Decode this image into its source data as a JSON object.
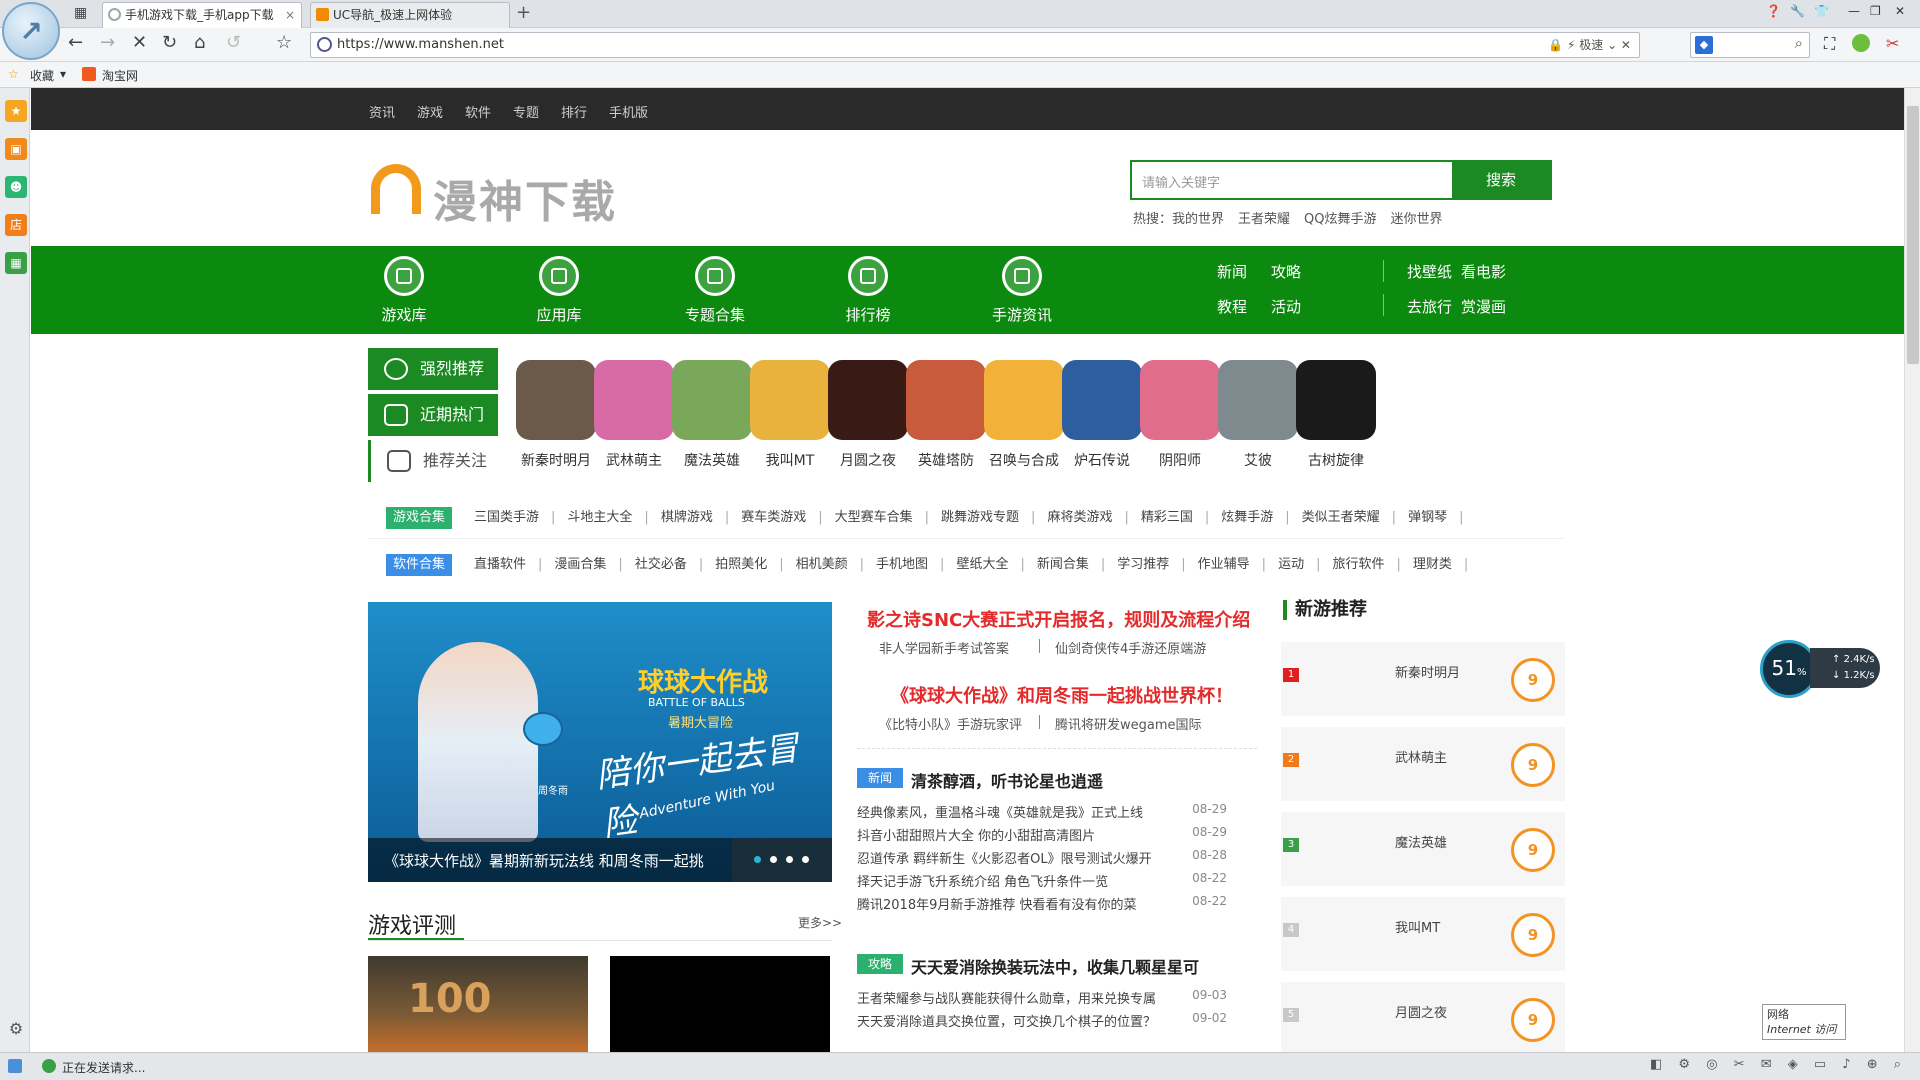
{
  "browser": {
    "tabs": [
      {
        "title": "手机游戏下载_手机app下载",
        "close": "×"
      },
      {
        "title": "UC导航_极速上网体验"
      }
    ],
    "new_tab": "+",
    "url": "https://www.manshen.net",
    "speed_mode": "极速",
    "bookmarks": [
      {
        "label": "收藏"
      },
      {
        "label": "淘宝网"
      }
    ],
    "status": "正在发送请求..."
  },
  "site": {
    "topnav": [
      "资讯",
      "游戏",
      "软件",
      "专题",
      "排行",
      "手机版"
    ],
    "brand": "漫神下载",
    "search": {
      "placeholder": "请输入关键字",
      "button": "搜索"
    },
    "hot": {
      "label": "热搜：",
      "items": [
        "我的世界",
        "王者荣耀",
        "QQ炫舞手游",
        "迷你世界"
      ]
    },
    "mainnav": [
      {
        "label": "游戏库",
        "icon": "gamepad-icon"
      },
      {
        "label": "应用库",
        "icon": "phone-icon"
      },
      {
        "label": "专题合集",
        "icon": "gift-icon"
      },
      {
        "label": "排行榜",
        "icon": "ranking-icon"
      },
      {
        "label": "手游资讯",
        "icon": "news-icon"
      }
    ],
    "nav_links": [
      "新闻",
      "攻略",
      "教程",
      "活动",
      "找壁纸",
      "看电影",
      "去旅行",
      "赏漫画"
    ],
    "rec_tabs": [
      "强烈推荐",
      "近期热门",
      "推荐关注"
    ],
    "games": [
      "新秦时明月",
      "武林萌主",
      "魔法英雄",
      "我叫MT",
      "月圆之夜",
      "英雄塔防",
      "召唤与合成",
      "炉石传说",
      "阴阳师",
      "艾彼",
      "古树旋律"
    ],
    "game_colors": [
      "#6b5a4a",
      "#d86aa6",
      "#7aa85a",
      "#e8b23c",
      "#3a1a14",
      "#c75b3c",
      "#f2b23a",
      "#2d5fa0",
      "#e06d8a",
      "#7f8a8e",
      "#1a1a1a"
    ],
    "game_collections": {
      "label": "游戏合集",
      "items": [
        "三国类手游",
        "斗地主大全",
        "棋牌游戏",
        "赛车类游戏",
        "大型赛车合集",
        "跳舞游戏专题",
        "麻将类游戏",
        "精彩三国",
        "炫舞手游",
        "类似王者荣耀",
        "弹钢琴"
      ]
    },
    "soft_collections": {
      "label": "软件合集",
      "items": [
        "直播软件",
        "漫画合集",
        "社交必备",
        "拍照美化",
        "相机美颜",
        "手机地图",
        "壁纸大全",
        "新闻合集",
        "学习推荐",
        "作业辅导",
        "运动",
        "旅行软件",
        "理财类"
      ]
    },
    "banner": {
      "title": "球球大作战",
      "subtitle": "BATTLE OF BALLS",
      "tag": "暑期大冒险",
      "slogan": "陪你一起去冒险",
      "english": "Adventure With You",
      "signature": "周冬雨",
      "caption": "《球球大作战》暑期新新玩法线 和周冬雨一起挑"
    },
    "headlines": [
      {
        "title": "影之诗SNC大赛正式开启报名，规则及流程介绍",
        "subs": [
          "非人学园新手考试答案",
          "仙剑奇侠传4手游还原端游"
        ]
      },
      {
        "title": "《球球大作战》和周冬雨一起挑战世界杯！",
        "subs": [
          "《比特小队》手游玩家评",
          "腾讯将研发wegame国际"
        ]
      }
    ],
    "news_block1": {
      "badge": "新闻",
      "title": "清茶醇酒，听书论星也逍遥",
      "items": [
        {
          "t": "经典像素风，重温格斗魂《英雄就是我》正式上线",
          "d": "08-29"
        },
        {
          "t": "抖音小甜甜照片大全 你的小甜甜高清图片",
          "d": "08-29"
        },
        {
          "t": "忍道传承 羁绊新生《火影忍者OL》限号测试火爆开",
          "d": "08-28"
        },
        {
          "t": "择天记手游飞升系统介绍 角色飞升条件一览",
          "d": "08-22"
        },
        {
          "t": "腾讯2018年9月新手游推荐 快看看有没有你的菜",
          "d": "08-22"
        }
      ]
    },
    "news_block2": {
      "badge": "攻略",
      "title": "天天爱消除换装玩法中，收集几颗星星可",
      "items": [
        {
          "t": "王者荣耀参与战队赛能获得什么勋章，用来兑换专属",
          "d": "09-03"
        },
        {
          "t": "天天爱消除道具交换位置，可交换几个棋子的位置？",
          "d": "09-02"
        }
      ]
    },
    "review": {
      "title": "游戏评测",
      "more": "更多>>"
    },
    "thumb_text": "100",
    "new_games": {
      "title": "新游推荐",
      "items": [
        {
          "rank": "1",
          "name": "新秦时明月",
          "score": "9"
        },
        {
          "rank": "2",
          "name": "武林萌主",
          "score": "9"
        },
        {
          "rank": "3",
          "name": "魔法英雄",
          "score": "9"
        },
        {
          "rank": "4",
          "name": "我叫MT",
          "score": "9"
        },
        {
          "rank": "5",
          "name": "月圆之夜",
          "score": "9"
        }
      ]
    }
  },
  "net_widget": {
    "percent": "51",
    "unit": "%",
    "up": "2.4K/s",
    "down": "1.2K/s",
    "label1": "网络",
    "label2": "Internet 访问"
  }
}
